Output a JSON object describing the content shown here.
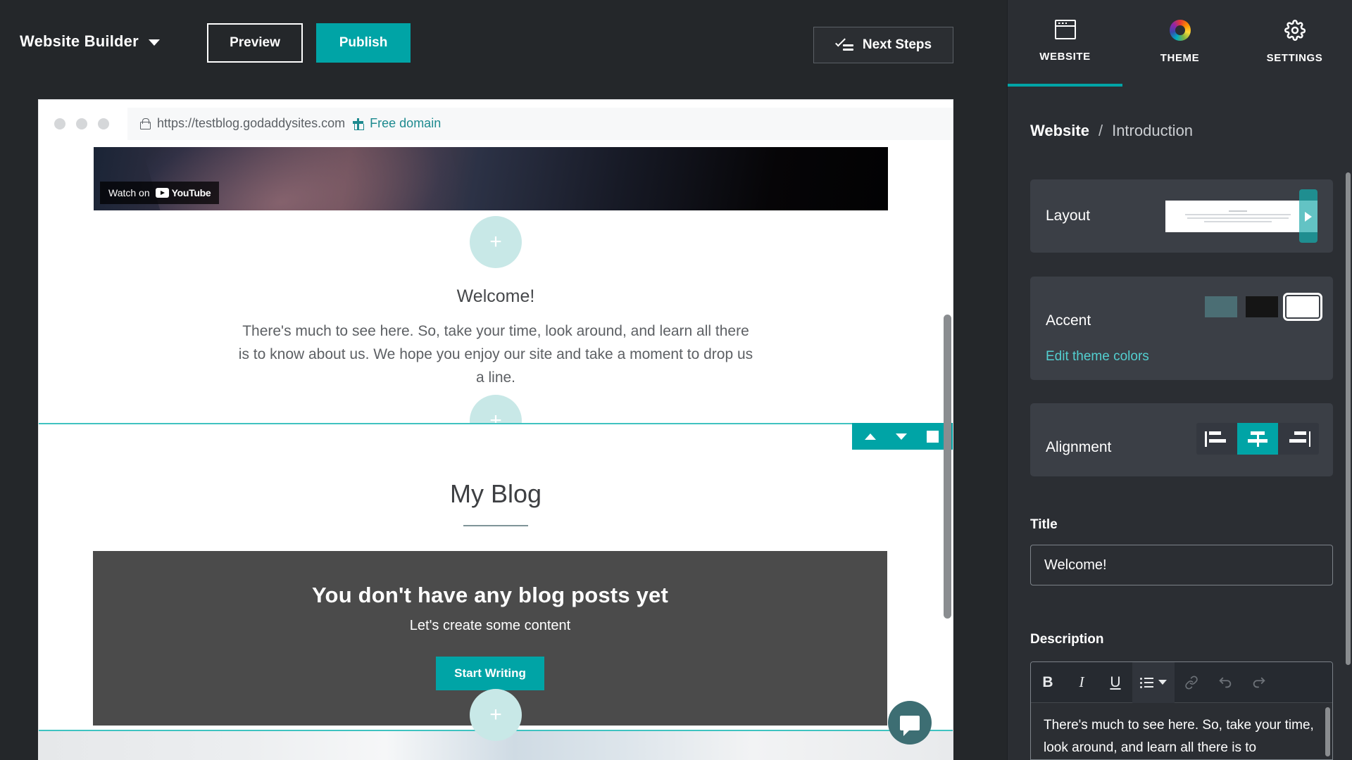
{
  "topbar": {
    "brand": "Website Builder",
    "chevron_icon": "chevron-down-icon",
    "preview_label": "Preview",
    "publish_label": "Publish",
    "next_steps_label": "Next Steps",
    "next_steps_icon": "checklist-icon",
    "publish_color": "#00a4a6"
  },
  "browser": {
    "url": "https://testblog.godaddysites.com",
    "free_domain_label": "Free domain",
    "free_domain_color": "#1d8a8f",
    "lock_icon": "lock-icon",
    "gift_icon": "gift-icon"
  },
  "site": {
    "video_badge_watch": "Watch on",
    "video_badge_brand": "YouTube",
    "add_section_glyph": "+",
    "welcome_title": "Welcome!",
    "welcome_body": "There's much to see here. So, take your time, look around, and learn all there is to know about us. We hope you enjoy our site and take a moment to drop us a line.",
    "blog_title": "My Blog",
    "blog_empty_heading": "You don't have any blog posts yet",
    "blog_empty_sub": "Let's create some content",
    "start_writing_label": "Start Writing",
    "selection_color": "#3fc3c1",
    "section_toolbar": {
      "move_up_icon": "chevron-up-icon",
      "move_down_icon": "chevron-down-icon",
      "duplicate_icon": "duplicate-icon",
      "more_icon": "ellipsis-icon"
    },
    "chat_icon": "chat-bubble-icon"
  },
  "panel": {
    "tabs": [
      {
        "label": "WEBSITE",
        "icon": "browser-window-icon",
        "active": true
      },
      {
        "label": "THEME",
        "icon": "color-wheel-icon",
        "active": false
      },
      {
        "label": "SETTINGS",
        "icon": "gear-icon",
        "active": false
      }
    ],
    "breadcrumb": {
      "root": "Website",
      "separator": "/",
      "current": "Introduction"
    },
    "layout": {
      "label": "Layout",
      "next_icon": "chevron-right-icon"
    },
    "accent": {
      "label": "Accent",
      "swatches": [
        {
          "color": "#4b6e74",
          "selected": false
        },
        {
          "color": "#151515",
          "selected": false
        },
        {
          "color": "#ffffff",
          "selected": true
        }
      ],
      "edit_link": "Edit theme colors",
      "edit_link_color": "#53cfd0"
    },
    "alignment": {
      "label": "Alignment",
      "options": [
        {
          "name": "align-left",
          "selected": false
        },
        {
          "name": "align-center",
          "selected": true
        },
        {
          "name": "align-right",
          "selected": false
        }
      ],
      "active_color": "#00a4a6"
    },
    "title": {
      "label": "Title",
      "value": "Welcome!"
    },
    "description": {
      "label": "Description",
      "value": "There's much to see here. So, take your time, look around, and learn all there is to",
      "toolbar": [
        {
          "name": "bold-button",
          "glyph": "B",
          "enabled": true
        },
        {
          "name": "italic-button",
          "glyph": "I",
          "enabled": true
        },
        {
          "name": "underline-button",
          "glyph": "U",
          "enabled": true
        },
        {
          "name": "list-button",
          "glyph": "list",
          "enabled": true
        },
        {
          "name": "link-button",
          "glyph": "link",
          "enabled": false
        },
        {
          "name": "undo-button",
          "glyph": "undo",
          "enabled": false
        },
        {
          "name": "redo-button",
          "glyph": "redo",
          "enabled": false
        }
      ]
    }
  }
}
